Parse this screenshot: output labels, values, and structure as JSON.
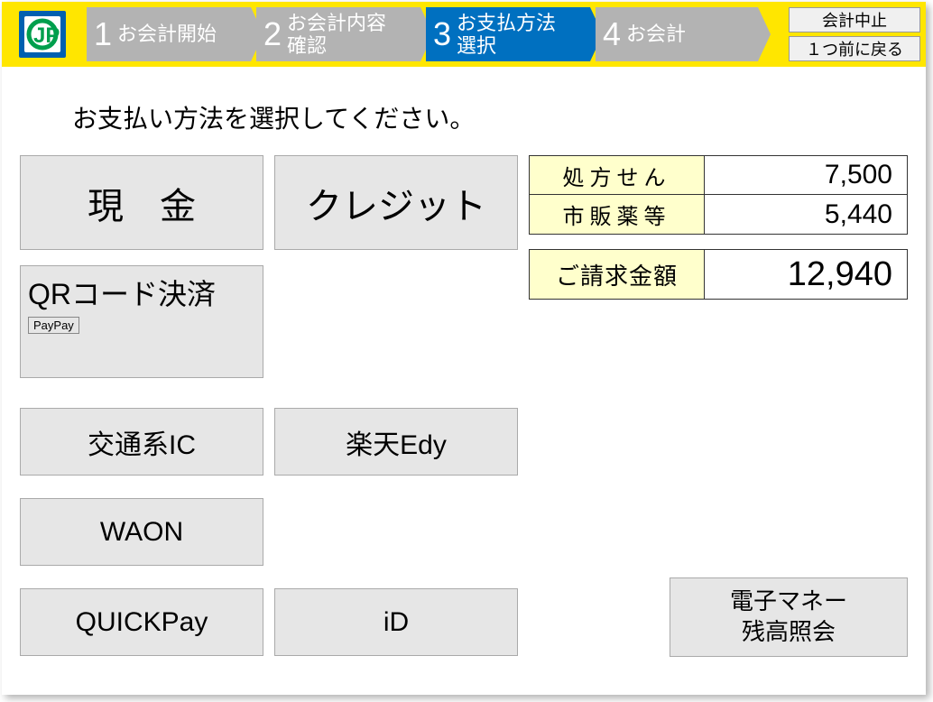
{
  "header": {
    "steps": [
      {
        "num": "1",
        "label": "お会計開始",
        "active": false
      },
      {
        "num": "2",
        "label": "お会計内容\n確認",
        "active": false
      },
      {
        "num": "3",
        "label": "お支払方法\n選択",
        "active": true
      },
      {
        "num": "4",
        "label": "お会計",
        "active": false
      }
    ],
    "cancel_label": "会計中止",
    "back_label": "１つ前に戻る"
  },
  "instruction": "お支払い方法を選択してください。",
  "payment": {
    "cash": "現　金",
    "credit": "クレジット",
    "qr": "QRコード決済",
    "qr_sub": "PayPay",
    "transit_ic": "交通系IC",
    "edy": "楽天Edy",
    "waon": "WAON",
    "quickpay": "QUICKPay",
    "id": "iD"
  },
  "amounts": {
    "prescription_label": "処方せん",
    "prescription_value": "7,500",
    "otc_label": "市販薬等",
    "otc_value": "5,440",
    "total_label": "ご請求金額",
    "total_value": "12,940"
  },
  "balance_check": {
    "line1": "電子マネー",
    "line2": "残高照会"
  }
}
